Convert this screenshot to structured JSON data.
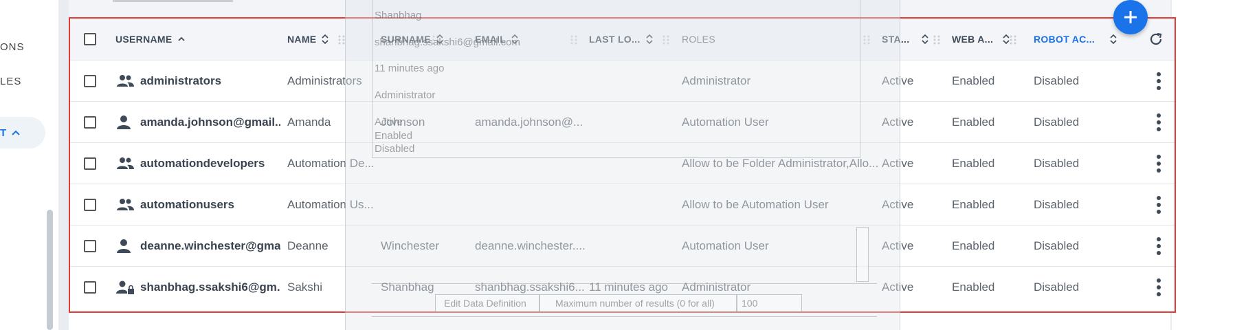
{
  "sidebar": {
    "items": [
      {
        "label": "ONS"
      },
      {
        "label": "LES"
      }
    ],
    "active_item": {
      "label": "T"
    }
  },
  "table": {
    "columns": [
      {
        "label": "USERNAME"
      },
      {
        "label": "NAME"
      },
      {
        "label": "SURNAME"
      },
      {
        "label": "EMAIL"
      },
      {
        "label": "LAST LO..."
      },
      {
        "label": "ROLES"
      },
      {
        "label": "STA..."
      },
      {
        "label": "WEB A..."
      },
      {
        "label": "ROBOT AC..."
      }
    ],
    "rows": [
      {
        "icon": "group-icon",
        "username": "administrators",
        "name": "Administrators",
        "surname": "",
        "email": "",
        "last_login": "",
        "roles": "Administrator",
        "status": "Active",
        "web_access": "Enabled",
        "robot_account": "Disabled"
      },
      {
        "icon": "person-icon",
        "username": "amanda.johnson@gmail....",
        "name": "Amanda",
        "surname": "Johnson",
        "email": "amanda.johnson@...",
        "last_login": "",
        "roles": "Automation User",
        "status": "Active",
        "web_access": "Enabled",
        "robot_account": "Disabled"
      },
      {
        "icon": "group-icon",
        "username": "automationdevelopers",
        "name": "Automation De...",
        "surname": "",
        "email": "",
        "last_login": "",
        "roles": "Allow to be Folder Administrator,Allo...",
        "status": "Active",
        "web_access": "Enabled",
        "robot_account": "Disabled"
      },
      {
        "icon": "group-icon",
        "username": "automationusers",
        "name": "Automation Us...",
        "surname": "",
        "email": "",
        "last_login": "",
        "roles": "Allow to be Automation User",
        "status": "Active",
        "web_access": "Enabled",
        "robot_account": "Disabled"
      },
      {
        "icon": "person-icon",
        "username": "deanne.winchester@gma...",
        "name": "Deanne",
        "surname": "Winchester",
        "email": "deanne.winchester....",
        "last_login": "",
        "roles": "Automation User",
        "status": "Active",
        "web_access": "Enabled",
        "robot_account": "Disabled"
      },
      {
        "icon": "person-lock-icon",
        "username": "shanbhag.ssakshi6@gm...",
        "name": "Sakshi",
        "surname": "Shanbhag",
        "email": "shanbhag.ssakshi6...",
        "last_login": "11 minutes ago",
        "roles": "Administrator",
        "status": "Active",
        "web_access": "Enabled",
        "robot_account": "Disabled"
      }
    ]
  },
  "ghost_overlay": {
    "lines": [
      "Shanbhag",
      "shanbhag.ssakshi6@gmail.com",
      "11 minutes ago",
      "Administrator",
      "Active",
      "Enabled",
      "Disabled"
    ],
    "edit_data_definition": "Edit Data Definition",
    "max_results_label": "Maximum number of results (0 for all)",
    "max_results_value": "100"
  },
  "colors": {
    "accent": "#1a73e8",
    "highlight_border": "#e53935"
  }
}
